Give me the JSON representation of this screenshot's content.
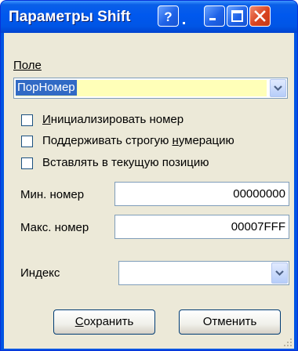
{
  "window": {
    "title": "Параметры Shift",
    "controls": [
      "help-icon",
      "minimize-icon",
      "maximize-icon",
      "close-icon"
    ]
  },
  "field_group": {
    "label": "Поле",
    "value": "ПорНомер"
  },
  "checkboxes": [
    {
      "label_pre": "",
      "label_u": "И",
      "label_post": "нициализировать номер",
      "checked": false
    },
    {
      "label_pre": "Поддерживать строгую ",
      "label_u": "н",
      "label_post": "умерацию",
      "checked": false
    },
    {
      "label_pre": "Вставлять в текущую позицию",
      "label_u": "",
      "label_post": "",
      "checked": false
    }
  ],
  "min_number": {
    "label": "Мин. номер",
    "value": "00000000"
  },
  "max_number": {
    "label": "Макс. номер",
    "value": "00007FFF"
  },
  "index": {
    "label": "Индекс",
    "value": ""
  },
  "buttons": {
    "save_u": "С",
    "save_rest": "охранить",
    "cancel": "Отменить"
  }
}
